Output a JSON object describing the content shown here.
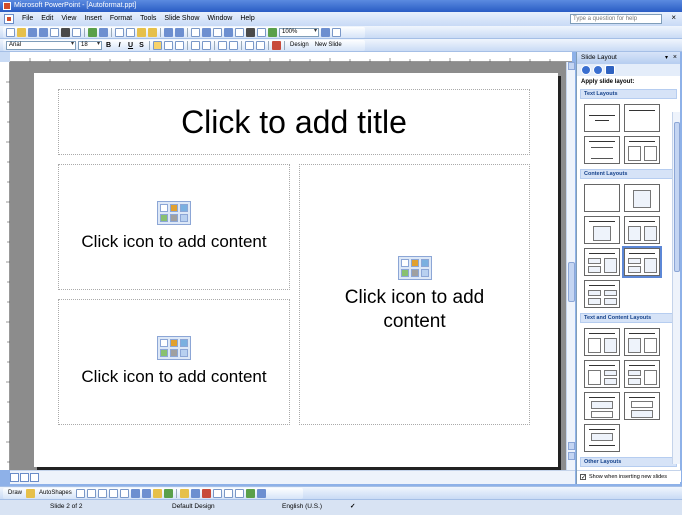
{
  "window": {
    "title": "Microsoft PowerPoint - [Autoformat.ppt]"
  },
  "menu": {
    "items": [
      "File",
      "Edit",
      "View",
      "Insert",
      "Format",
      "Tools",
      "Slide Show",
      "Window",
      "Help"
    ],
    "help_placeholder": "Type a question for help"
  },
  "standard_toolbar": {
    "zoom": "100%"
  },
  "formatting_toolbar": {
    "font": "Arial",
    "size": "18",
    "bold": "B",
    "italic": "I",
    "underline": "U",
    "shadow": "S",
    "design_label": "Design",
    "new_slide_label": "New Slide"
  },
  "slide": {
    "title_placeholder": "Click to add title",
    "content_placeholder_1": "Click icon to add content",
    "content_placeholder_2": "Click icon to add content",
    "content_placeholder_3": "Click icon to add content"
  },
  "task_pane": {
    "title": "Slide Layout",
    "apply_label": "Apply slide layout:",
    "sections": {
      "text": "Text Layouts",
      "content": "Content Layouts",
      "text_and_content": "Text and Content Layouts",
      "other": "Other Layouts"
    },
    "show_when_inserting": "Show when inserting new slides"
  },
  "drawing_toolbar": {
    "draw_label": "Draw",
    "autoshapes_label": "AutoShapes"
  },
  "status": {
    "slide": "Slide 2 of 2",
    "design": "Default Design",
    "language": "English (U.S.)"
  },
  "colors": {
    "accent": "#2a5cc4",
    "toolbar": "#c9dbf5"
  }
}
